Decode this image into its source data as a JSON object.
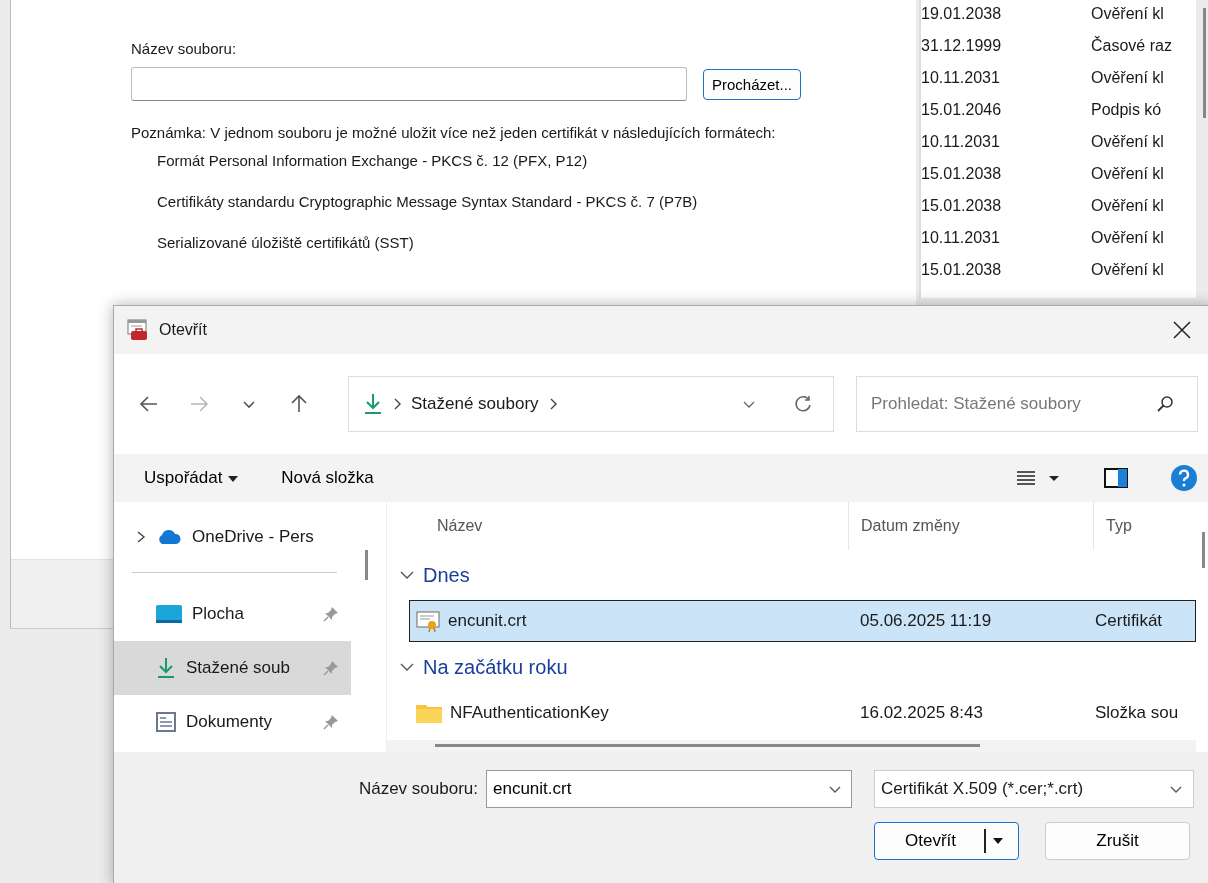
{
  "background_window": {
    "file_name_label": "Název souboru:",
    "browse_button": "Procházet...",
    "note": "Poznámka: V jednom souboru je možné uložit více než jeden certifikát v následujících formátech:",
    "formats": [
      "Formát Personal Information Exchange - PKCS č. 12 (PFX, P12)",
      "Certifikáty standardu Cryptographic Message Syntax Standard - PKCS č. 7 (P7B)",
      "Serializované úložiště certifikátů (SST)"
    ]
  },
  "certificate_list": [
    {
      "date": "19.01.2038",
      "purpose": "Ověření kl"
    },
    {
      "date": "31.12.1999",
      "purpose": "Časové raz"
    },
    {
      "date": "10.11.2031",
      "purpose": "Ověření kl"
    },
    {
      "date": "15.01.2046",
      "purpose": "Podpis kó"
    },
    {
      "date": "10.11.2031",
      "purpose": "Ověření kl"
    },
    {
      "date": "15.01.2038",
      "purpose": "Ověření kl"
    },
    {
      "date": "15.01.2038",
      "purpose": "Ověření kl"
    },
    {
      "date": "10.11.2031",
      "purpose": "Ověření kl"
    },
    {
      "date": "15.01.2038",
      "purpose": "Ověření kl"
    }
  ],
  "open_dialog": {
    "title": "Otevřít",
    "nav": [
      {
        "kind": "back",
        "disabled": false
      },
      {
        "kind": "forward",
        "disabled": true
      },
      {
        "kind": "recent",
        "disabled": false
      },
      {
        "kind": "up",
        "disabled": false
      }
    ],
    "address": {
      "path_item": "Stažené soubory"
    },
    "search": {
      "placeholder": "Prohledat: Stažené soubory"
    },
    "toolbar": {
      "organize": "Uspořádat",
      "new_folder": "Nová složka"
    },
    "sidebar": [
      {
        "kind": "cloud",
        "label": "OneDrive - Pers",
        "expandable": true,
        "pinned": false,
        "selected": false
      },
      {
        "kind": "desktop",
        "label": "Plocha",
        "expandable": false,
        "pinned": true,
        "selected": false
      },
      {
        "kind": "downloads",
        "label": "Stažené soub",
        "expandable": false,
        "pinned": true,
        "selected": true
      },
      {
        "kind": "documents",
        "label": "Dokumenty",
        "expandable": false,
        "pinned": true,
        "selected": false
      }
    ],
    "columns": [
      "Název",
      "Datum změny",
      "Typ"
    ],
    "groups": [
      {
        "label": "Dnes",
        "expanded": true,
        "files": [
          {
            "kind": "certificate",
            "name": "encunit.crt",
            "date": "05.06.2025 11:19",
            "type": "Certifikát",
            "selected": true
          }
        ]
      },
      {
        "label": "Na začátku roku",
        "expanded": true,
        "files": [
          {
            "kind": "folder",
            "name": "NFAuthenticationKey",
            "date": "16.02.2025 8:43",
            "type": "Složka sou",
            "selected": false
          }
        ]
      }
    ],
    "footer": {
      "file_name_label": "Název souboru:",
      "file_name_value": "encunit.crt",
      "file_type": "Certifikát X.509 (*.cer;*.crt)",
      "open_button": "Otevřít",
      "cancel_button": "Zrušit"
    }
  }
}
